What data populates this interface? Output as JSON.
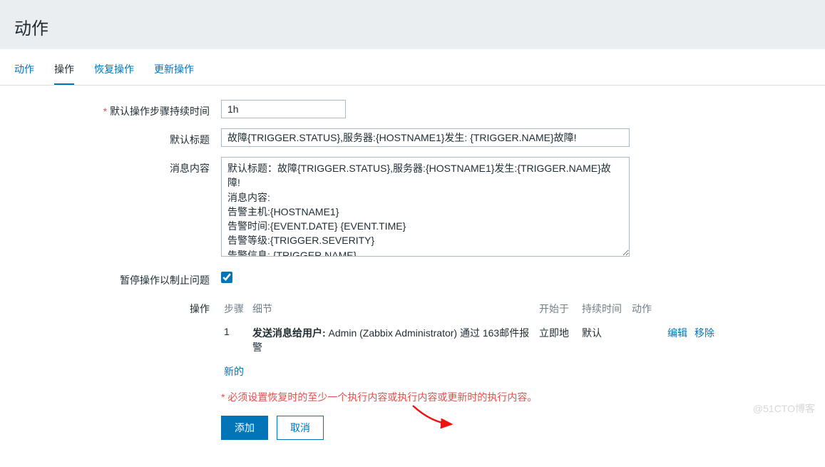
{
  "page": {
    "title": "动作"
  },
  "tabs": [
    {
      "label": "动作"
    },
    {
      "label": "操作"
    },
    {
      "label": "恢复操作"
    },
    {
      "label": "更新操作"
    }
  ],
  "fields": {
    "duration": {
      "label": "默认操作步骤持续时间",
      "value": "1h"
    },
    "subject": {
      "label": "默认标题",
      "value": "故障{TRIGGER.STATUS},服务器:{HOSTNAME1}发生: {TRIGGER.NAME}故障!"
    },
    "message": {
      "label": "消息内容",
      "value": "默认标题：故障{TRIGGER.STATUS},服务器:{HOSTNAME1}发生:{TRIGGER.NAME}故障!\n消息内容:\n告警主机:{HOSTNAME1}\n告警时间:{EVENT.DATE} {EVENT.TIME}\n告警等级:{TRIGGER.SEVERITY}\n告警信息: {TRIGGER.NAME}"
    },
    "pause": {
      "label": "暂停操作以制止问题",
      "checked": true
    },
    "ops": {
      "label": "操作",
      "headers": {
        "step": "步骤",
        "detail": "细节",
        "start": "开始于",
        "duration": "持续时间",
        "action": "动作"
      },
      "rows": [
        {
          "step": "1",
          "detail_bold": "发送消息给用户:",
          "detail_rest": " Admin (Zabbix Administrator) 通过 163邮件报警",
          "start": "立即地",
          "duration": "默认",
          "edit": "编辑",
          "remove": "移除"
        }
      ],
      "new": "新的"
    },
    "validation": "必须设置恢复时的至少一个执行内容或执行内容或更新时的执行内容。",
    "buttons": {
      "add": "添加",
      "cancel": "取消"
    }
  },
  "watermark": "@51CTO博客"
}
